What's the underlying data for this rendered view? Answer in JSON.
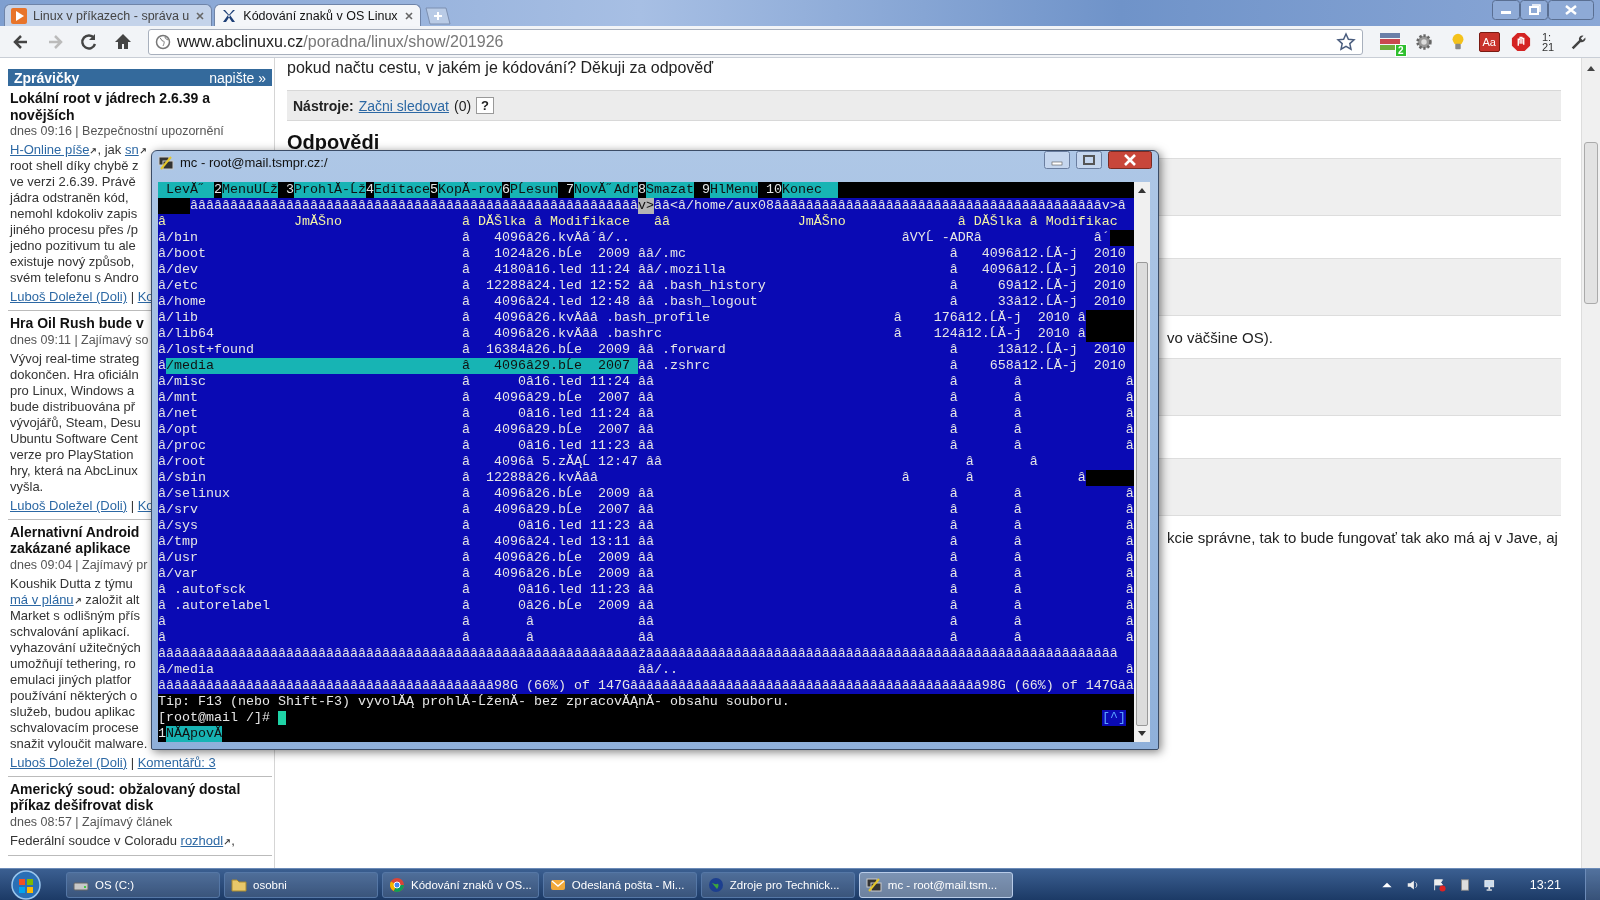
{
  "browser": {
    "tabs": [
      {
        "title": "Linux v příkazech - správa u",
        "selected": false
      },
      {
        "title": "Kódování znaků v OS Linux",
        "selected": true
      }
    ],
    "url_host": "www.abclinuxu.cz",
    "url_path": "/poradna/linux/show/201926",
    "extension_badge": "2",
    "dictionary_label": "Aa",
    "clock_lines": [
      "1:",
      "21"
    ]
  },
  "sidebar": {
    "title": "Zprávičky",
    "action": "napište »",
    "news": [
      {
        "title_lines": [
          "Lokální root v jádrech 2.6.39 a",
          "novějších"
        ],
        "meta": "dnes 09:16 | Bezpečnostní upozornění",
        "body": [
          [
            {
              "text": "H-Online píše",
              "kind": "link"
            },
            {
              "text": ", jak ",
              "kind": "text"
            },
            {
              "text": "sn",
              "kind": "link"
            }
          ],
          [
            {
              "text": "root shell díky chybě z",
              "kind": "text"
            }
          ],
          [
            {
              "text": "ve verzi 2.6.39. Právě",
              "kind": "text"
            }
          ],
          [
            {
              "text": "jádra odstraněn kód,",
              "kind": "text"
            }
          ],
          [
            {
              "text": "nemohl kdokoliv zapis",
              "kind": "text"
            }
          ],
          [
            {
              "text": "jiného procesu přes /p",
              "kind": "text"
            }
          ],
          [
            {
              "text": "jedno pozitivum tu ale",
              "kind": "text"
            }
          ],
          [
            {
              "text": "existuje nový způsob,",
              "kind": "text"
            }
          ],
          [
            {
              "text": "svém telefonu s Andro",
              "kind": "text"
            }
          ]
        ],
        "footer": [
          {
            "text": "Luboš Doležel (Doli)",
            "kind": "link"
          },
          {
            "text": " | ",
            "kind": "text"
          },
          {
            "text": "Ko",
            "kind": "link"
          }
        ]
      },
      {
        "title_lines": [
          "Hra Oil Rush bude v"
        ],
        "meta": "dnes 09:11 | Zajímavý so",
        "body": [
          [
            {
              "text": "Vývoj real-time strateg",
              "kind": "text"
            }
          ],
          [
            {
              "text": "dokončen. Hra oficiáln",
              "kind": "text"
            }
          ],
          [
            {
              "text": "pro Linux, Windows a",
              "kind": "text"
            }
          ],
          [
            {
              "text": "bude distribuována př",
              "kind": "text"
            }
          ],
          [
            {
              "text": "vývojářů, Steam, Desu",
              "kind": "text"
            }
          ],
          [
            {
              "text": "Ubuntu Software Cent",
              "kind": "text"
            }
          ],
          [
            {
              "text": "verze pro PlayStation",
              "kind": "text"
            }
          ],
          [
            {
              "text": "hry, která na AbcLinux",
              "kind": "text"
            }
          ],
          [
            {
              "text": "vyšla.",
              "kind": "text"
            }
          ]
        ],
        "footer": [
          {
            "text": "Luboš Doležel (Doli)",
            "kind": "link"
          },
          {
            "text": " | ",
            "kind": "text"
          },
          {
            "text": "Ko",
            "kind": "link"
          }
        ]
      },
      {
        "title_lines": [
          "Alernativní Android",
          "zakázané aplikace"
        ],
        "meta": "dnes 09:04 | Zajímavý pr",
        "body": [
          [
            {
              "text": "Koushik Dutta z týmu",
              "kind": "text"
            }
          ],
          [
            {
              "text": "má v plánu",
              "kind": "link"
            },
            {
              "text": " založit alt",
              "kind": "text"
            }
          ],
          [
            {
              "text": "Market s odlišným přís",
              "kind": "text"
            }
          ],
          [
            {
              "text": "schvalování aplikací.",
              "kind": "text"
            }
          ],
          [
            {
              "text": "vyhazování užitečných",
              "kind": "text"
            }
          ],
          [
            {
              "text": "umožňují tethering, ro",
              "kind": "text"
            }
          ],
          [
            {
              "text": "emulaci jiných platfor",
              "kind": "text"
            }
          ],
          [
            {
              "text": "používání některých o",
              "kind": "text"
            }
          ],
          [
            {
              "text": "služeb, budou aplikac",
              "kind": "text"
            }
          ],
          [
            {
              "text": "schvalovacím procese",
              "kind": "text"
            }
          ],
          [
            {
              "text": "snažit vyloučit malware.",
              "kind": "text"
            }
          ]
        ],
        "footer": [
          {
            "text": "Luboš Doležel (Doli)",
            "kind": "link"
          },
          {
            "text": " | ",
            "kind": "text"
          },
          {
            "text": "Komentářů: 3",
            "kind": "link"
          }
        ]
      },
      {
        "title_lines": [
          "Americký soud: obžalovaný dostal",
          "příkaz dešifrovat disk"
        ],
        "meta": "dnes 08:57 | Zajímavý článek",
        "body": [
          [
            {
              "text": "Federální soudce v Coloradu ",
              "kind": "text"
            },
            {
              "text": "rozhodl",
              "kind": "link"
            },
            {
              "text": ",",
              "kind": "text"
            }
          ]
        ]
      }
    ]
  },
  "main": {
    "question_tail": "pokud načtu cestu, v jakém je kódování? Děkuji za odpověď",
    "tools_label": "Nástroje:",
    "tools_link": "Začni sledovat",
    "tools_count": "(0)",
    "tools_help": "?",
    "heading": "Odpovědi",
    "answers": [
      {
        "kind": "covered"
      },
      {
        "kind": "excerpt",
        "excerpt": "vo väčšine OS)."
      },
      {
        "kind": "covered"
      },
      {
        "kind": "excerpt",
        "excerpt": "kcie správne, tak to bude fungovať tak ako má aj v Jave, aj"
      }
    ]
  },
  "terminal": {
    "title": "mc - root@mail.tsmpr.cz:/",
    "lines": [
      {
        "kind": "menu",
        "segments": [
          {
            "text": " LevĂ˝ ",
            "kind": "bar"
          },
          {
            "text": "2",
            "kind": "key"
          },
          {
            "text": "MenuUĹž",
            "kind": "bar"
          },
          {
            "text": " 3",
            "kind": "key"
          },
          {
            "text": "ProhlĂ-Ĺž",
            "kind": "bar"
          },
          {
            "text": "4",
            "kind": "key"
          },
          {
            "text": "Editace",
            "kind": "bar"
          },
          {
            "text": "5",
            "kind": "key"
          },
          {
            "text": "KopĂ-rov",
            "kind": "bar"
          },
          {
            "text": "6",
            "kind": "key"
          },
          {
            "text": "PĹesun",
            "kind": "bar"
          },
          {
            "text": " 7",
            "kind": "key"
          },
          {
            "text": "NovĂ˝Adr",
            "kind": "bar"
          },
          {
            "text": "8",
            "kind": "key"
          },
          {
            "text": "Smazat",
            "kind": "bar"
          },
          {
            "text": " 9",
            "kind": "key"
          },
          {
            "text": "HlMenu",
            "kind": "bar"
          },
          {
            "text": " 10",
            "kind": "key"
          },
          {
            "text": "Konec  ",
            "kind": "bar"
          }
        ]
      },
      {
        "kind": "panel",
        "segments": [
          {
            "kind": "block"
          },
          {
            "text": "ââââââââââââââââââââââââââââââââââââââââââââââââââââââââ",
            "kind": "text"
          },
          {
            "text": "v>",
            "kind": "mark"
          },
          {
            "text": "ââ<â/home/aux08âââââââââââââââââââââââââââââââââââââââââv>â",
            "kind": "text"
          }
        ]
      },
      {
        "kind": "panel",
        "segments": [
          {
            "text": "â                JmĂŠno               â DĂŠlka â Modifikace   ââ                JmĂŠno              â DĂŠlka â Modifikac",
            "kind": "header"
          }
        ]
      },
      {
        "kind": "panel",
        "segments": [
          {
            "text": "â/bin                                 â   4096â26.kvÄâ´â/..                                  âVYĹ -ADRâ              â´",
            "kind": "text"
          },
          {
            "kind": "block"
          }
        ]
      },
      {
        "kind": "panel",
        "segments": [
          {
            "text": "â/boot                                â   1024â26.bĹe  2009 ââ/.mc                                 â   4096â12.ĹĂ-j  2010",
            "kind": "text"
          }
        ]
      },
      {
        "kind": "panel",
        "segments": [
          {
            "text": "â/dev                                 â   4180â16.led 11:24 ââ/.mozilla                            â   4096â12.ĹĂ-j  2010",
            "kind": "text"
          }
        ]
      },
      {
        "kind": "panel",
        "segments": [
          {
            "text": "â/etc                                 â  12288â24.led 12:52 ââ .bash_history                       â     69â12.ĹĂ-j  2010",
            "kind": "text"
          }
        ]
      },
      {
        "kind": "panel",
        "segments": [
          {
            "text": "â/home                                â   4096â24.led 12:48 ââ .bash_logout                        â     33â12.ĹĂ-j  2010",
            "kind": "text"
          }
        ]
      },
      {
        "kind": "panel",
        "segments": [
          {
            "text": "â/lib                                 â   4096â26.kvÄââ .bash_profile                       â    176â12.ĹĂ-j  2010 â",
            "kind": "text"
          },
          {
            "kind": "block"
          }
        ]
      },
      {
        "kind": "panel",
        "segments": [
          {
            "text": "â/lib64                               â   4096â26.kvÄââ .bashrc                             â    124â12.ĹĂ-j  2010 â",
            "kind": "text"
          },
          {
            "kind": "block"
          }
        ]
      },
      {
        "kind": "panel",
        "segments": [
          {
            "text": "â/lost+found                          â  16384â26.bĹe  2009 ââ .forward                            â     13â12.ĹĂ-j  2010",
            "kind": "text"
          }
        ]
      },
      {
        "kind": "panel",
        "segments": [
          {
            "text": "â",
            "kind": "text"
          },
          {
            "text": "/media                               â   4096â29.bĹe  2007 ",
            "kind": "selected"
          },
          {
            "text": "ââ .zshrc                              â    658â12.ĹĂ-j  2010",
            "kind": "text"
          }
        ]
      },
      {
        "kind": "panel",
        "segments": [
          {
            "text": "â/misc                                â      0â16.led 11:24 ââ                                     â       â             â",
            "kind": "text"
          }
        ]
      },
      {
        "kind": "panel",
        "segments": [
          {
            "text": "â/mnt                                 â   4096â29.bĹe  2007 ââ                                     â       â             â",
            "kind": "text"
          }
        ]
      },
      {
        "kind": "panel",
        "segments": [
          {
            "text": "â/net                                 â      0â16.led 11:24 ââ                                     â       â             â",
            "kind": "text"
          }
        ]
      },
      {
        "kind": "panel",
        "segments": [
          {
            "text": "â/opt                                 â   4096â29.bĹe  2007 ââ                                     â       â             â",
            "kind": "text"
          }
        ]
      },
      {
        "kind": "panel",
        "segments": [
          {
            "text": "â/proc                                â      0â16.led 11:23 ââ                                     â       â             â",
            "kind": "text"
          }
        ]
      },
      {
        "kind": "panel",
        "segments": [
          {
            "text": "â/root                                â   4096â 5.zĂĄĹ 12:47 ââ                                      â       â",
            "kind": "text"
          }
        ]
      },
      {
        "kind": "panel",
        "segments": [
          {
            "text": "â/sbin                                â  12288â26.kvÄââ                                      â       â             â",
            "kind": "text"
          },
          {
            "kind": "block"
          }
        ]
      },
      {
        "kind": "panel",
        "segments": [
          {
            "text": "â/selinux                             â   4096â26.bĹe  2009 ââ                                     â       â             â",
            "kind": "text"
          }
        ]
      },
      {
        "kind": "panel",
        "segments": [
          {
            "text": "â/srv                                 â   4096â29.bĹe  2007 ââ                                     â       â             â",
            "kind": "text"
          }
        ]
      },
      {
        "kind": "panel",
        "segments": [
          {
            "text": "â/sys                                 â      0â16.led 11:23 ââ                                     â       â             â",
            "kind": "text"
          }
        ]
      },
      {
        "kind": "panel",
        "segments": [
          {
            "text": "â/tmp                                 â   4096â24.led 13:11 ââ                                     â       â             â",
            "kind": "text"
          }
        ]
      },
      {
        "kind": "panel",
        "segments": [
          {
            "text": "â/usr                                 â   4096â26.bĹe  2009 ââ                                     â       â             â",
            "kind": "text"
          }
        ]
      },
      {
        "kind": "panel",
        "segments": [
          {
            "text": "â/var                                 â   4096â26.bĹe  2009 ââ                                     â       â             â",
            "kind": "text"
          }
        ]
      },
      {
        "kind": "panel",
        "segments": [
          {
            "text": "â .autofsck                           â      0â16.led 11:23 ââ                                     â       â             â",
            "kind": "text"
          }
        ]
      },
      {
        "kind": "panel",
        "segments": [
          {
            "text": "â .autorelabel                        â      0â26.bĹe  2009 ââ                                     â       â             â",
            "kind": "text"
          }
        ]
      },
      {
        "kind": "panel",
        "segments": [
          {
            "text": "â                                     â       â             ââ                                     â       â             â",
            "kind": "text"
          }
        ]
      },
      {
        "kind": "panel",
        "segments": [
          {
            "text": "â                                     â       â             ââ                                     â       â             â",
            "kind": "text"
          }
        ]
      },
      {
        "kind": "panel",
        "segments": [
          {
            "text": "ââââââââââââââââââââââââââââââââââââââââââââââââââââââââââââžâââââââââââââââââââââââââââââââââââââââââââââââââââââââââââ",
            "kind": "text"
          }
        ]
      },
      {
        "kind": "panel",
        "segments": [
          {
            "text": "â/media                                                     ââ/..                                                        â",
            "kind": "text"
          }
        ]
      },
      {
        "kind": "panel",
        "segments": [
          {
            "text": "ââââââââââââââââââââââââââââââââââââââââââ98G (66%) of 147Gââââââââââââââââââââââââââââââââââââââââââââ98G (66%) of 147Gââ",
            "kind": "text"
          }
        ]
      },
      {
        "kind": "console",
        "segments": [
          {
            "text": "Tip: F13 (nebo Shift-F3) vyvolĂĄ prohlĂ-ĹženĂ- bez zpracovĂĄnĂ- obsahu souboru.",
            "kind": "text"
          }
        ]
      },
      {
        "kind": "console",
        "segments": [
          {
            "text": "[root@mail /]# ",
            "kind": "text"
          },
          {
            "kind": "cursor"
          },
          {
            "text": "[^]",
            "kind": "corner"
          }
        ]
      },
      {
        "kind": "console",
        "segments": [
          {
            "text": "1",
            "kind": "key"
          },
          {
            "text": "NĂĄpovĂ",
            "kind": "bar"
          }
        ]
      }
    ]
  },
  "taskbar": {
    "buttons": [
      {
        "label": "OS (C:)",
        "selected": false
      },
      {
        "label": "osobni",
        "selected": false
      },
      {
        "label": "Kódování znaků v OS...",
        "selected": false
      },
      {
        "label": "Odeslaná pošta - Mi...",
        "selected": false
      },
      {
        "label": "Zdroje pro Technick...",
        "selected": false
      },
      {
        "label": "mc - root@mail.tsm...",
        "selected": true
      }
    ],
    "clock": "13:21"
  }
}
